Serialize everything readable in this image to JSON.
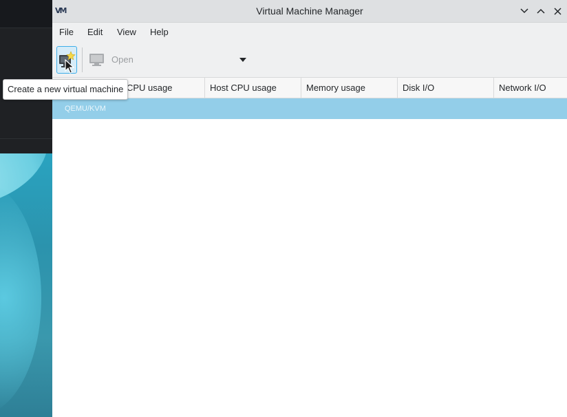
{
  "window": {
    "title": "Virtual Machine Manager",
    "logo": "VM"
  },
  "menu": {
    "items": [
      "File",
      "Edit",
      "View",
      "Help"
    ]
  },
  "toolbar": {
    "new_icon": "new-vm-icon",
    "open_label": "Open",
    "open_icon": "monitor-icon"
  },
  "columns": [
    "CPU usage",
    "Host CPU usage",
    "Memory usage",
    "Disk I/O",
    "Network I/O"
  ],
  "rows": [
    {
      "name": "QEMU/KVM",
      "selected": true
    }
  ],
  "tooltip": {
    "text": "Create a new virtual machine"
  },
  "colors": {
    "accent": "#3daee9",
    "selection": "#93cee9",
    "titlebar": "#dee0e2",
    "chrome": "#eff0f1"
  }
}
